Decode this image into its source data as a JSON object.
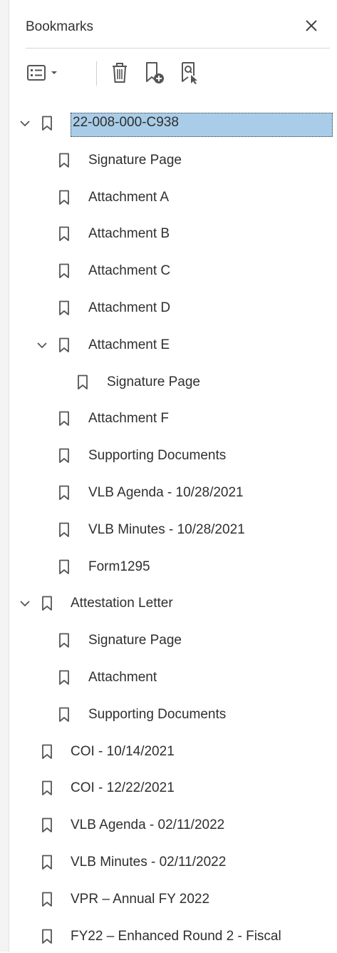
{
  "panel": {
    "title": "Bookmarks",
    "icons": {
      "close": "close-icon",
      "options": "list-options-icon",
      "delete": "trash-icon",
      "new_bookmark": "new-bookmark-icon",
      "find_bookmark": "find-bookmark-icon"
    }
  },
  "colors": {
    "selection": "#a9cde8",
    "icon": "#555555",
    "text": "#2f2f2f"
  },
  "bookmarks": [
    {
      "label": "22-008-000-C938",
      "level": 0,
      "expanded": true,
      "selected": true
    },
    {
      "label": "Signature Page",
      "level": 1
    },
    {
      "label": "Attachment A",
      "level": 1
    },
    {
      "label": "Attachment B",
      "level": 1
    },
    {
      "label": "Attachment C",
      "level": 1
    },
    {
      "label": "Attachment D",
      "level": 1
    },
    {
      "label": "Attachment E",
      "level": 1,
      "expanded": true
    },
    {
      "label": "Signature Page",
      "level": 2
    },
    {
      "label": "Attachment F",
      "level": 1
    },
    {
      "label": "Supporting Documents",
      "level": 1
    },
    {
      "label": "VLB Agenda - 10/28/2021",
      "level": 1
    },
    {
      "label": "VLB Minutes - 10/28/2021",
      "level": 1
    },
    {
      "label": "Form1295",
      "level": 1
    },
    {
      "label": "Attestation Letter",
      "level": 0,
      "expanded": true
    },
    {
      "label": "Signature Page",
      "level": 1
    },
    {
      "label": "Attachment",
      "level": 1
    },
    {
      "label": "Supporting Documents",
      "level": 1
    },
    {
      "label": "COI - 10/14/2021",
      "level": 0
    },
    {
      "label": "COI - 12/22/2021",
      "level": 0
    },
    {
      "label": "VLB Agenda - 02/11/2022",
      "level": 0
    },
    {
      "label": "VLB Minutes - 02/11/2022",
      "level": 0
    },
    {
      "label": "VPR – Annual FY 2022",
      "level": 0
    },
    {
      "label": "FY22 – Enhanced Round 2 - Fiscal",
      "level": 0
    }
  ]
}
